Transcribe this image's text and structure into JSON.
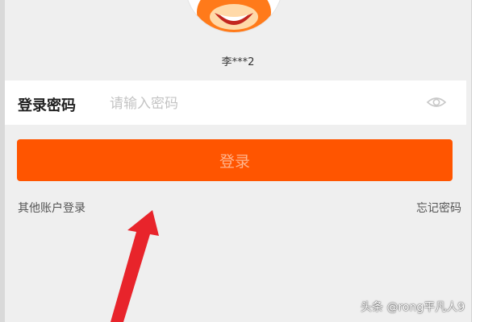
{
  "user": {
    "masked_name": "李***2"
  },
  "password_row": {
    "label": "登录密码",
    "placeholder": "请输入密码",
    "toggle_icon": "eye-icon"
  },
  "login_button": {
    "label": "登录"
  },
  "links": {
    "other_account": "其他账户登录",
    "forgot_password": "忘记密码"
  },
  "annotation": {
    "icon": "red-arrow-icon"
  },
  "watermark": "头条 @rong平凡人9",
  "colors": {
    "accent": "#ff5500",
    "button_text": "#ffb48c",
    "annotation_arrow": "#e8242b",
    "background": "#efefef"
  }
}
